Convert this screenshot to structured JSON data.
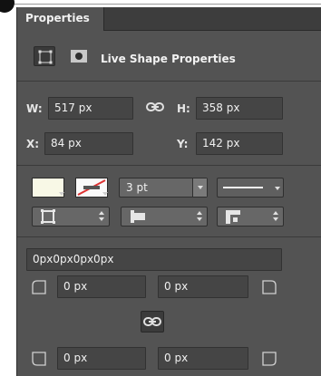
{
  "panel": {
    "tab_label": "Properties",
    "header_label": "Live Shape Properties"
  },
  "dimensions": {
    "w_label": "W:",
    "w_value": "517 px",
    "h_label": "H:",
    "h_value": "358 px",
    "x_label": "X:",
    "x_value": "84 px",
    "y_label": "Y:",
    "y_value": "142 px"
  },
  "stroke": {
    "fill_color": "#f8f8e6",
    "weight_value": "3 pt"
  },
  "corners": {
    "radius_summary": "0px0px0px0px",
    "top_left": "0 px",
    "top_right": "0 px",
    "bottom_left": "0 px",
    "bottom_right": "0 px"
  },
  "icons": {
    "shape": "transform-square-icon",
    "mask": "mask-icon",
    "link": "chain-link-icon"
  }
}
